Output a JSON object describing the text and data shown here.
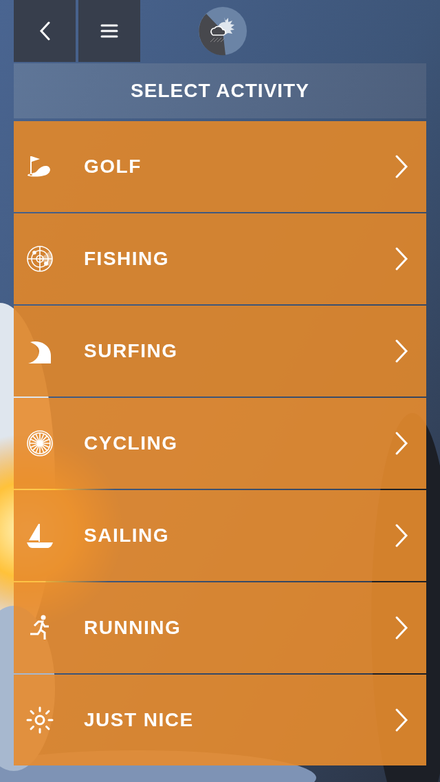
{
  "header": {
    "title": "SELECT ACTIVITY"
  },
  "activities": [
    {
      "label": "GOLF",
      "kind": "golf"
    },
    {
      "label": "FISHING",
      "kind": "fishing"
    },
    {
      "label": "SURFING",
      "kind": "surfing"
    },
    {
      "label": "CYCLING",
      "kind": "cycling"
    },
    {
      "label": "SAILING",
      "kind": "sailing"
    },
    {
      "label": "RUNNING",
      "kind": "running"
    },
    {
      "label": "JUST NICE",
      "kind": "sun"
    }
  ]
}
